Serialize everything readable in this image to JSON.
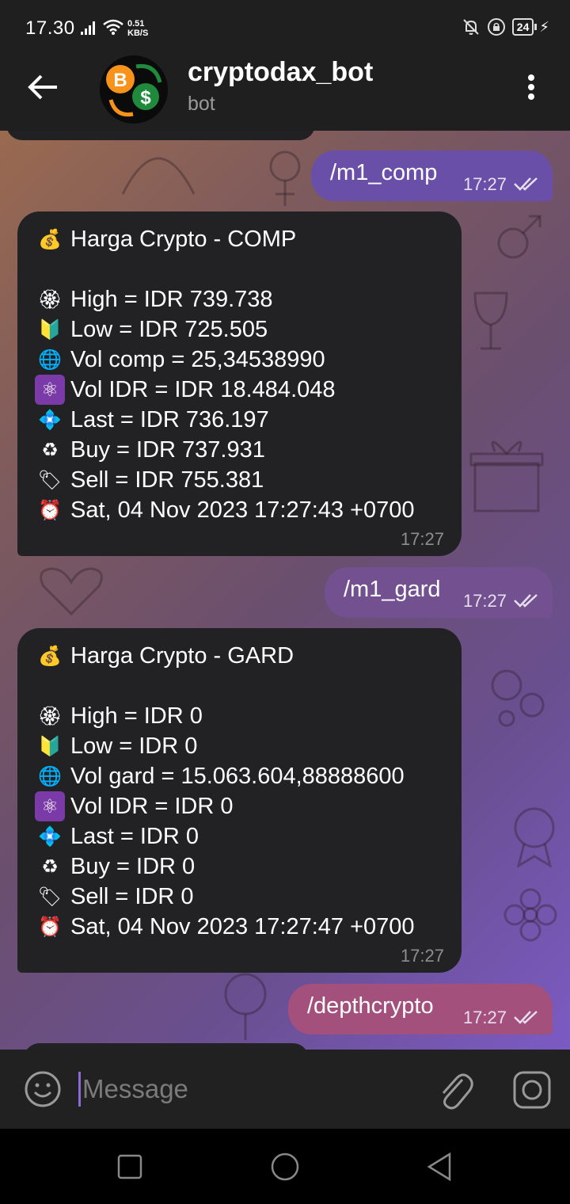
{
  "status_bar": {
    "time": "17.30",
    "net_speed_value": "0.51",
    "net_speed_unit": "KB/S",
    "battery": "24"
  },
  "header": {
    "title": "cryptodax_bot",
    "subtitle": "bot"
  },
  "messages": [
    {
      "type": "outgoing",
      "text": "/m1_comp",
      "time": "17:27",
      "color": "#6a4fa8"
    },
    {
      "type": "incoming",
      "title": "Harga Crypto - COMP",
      "lines": [
        {
          "icon": "money-bag-icon",
          "emoji": "💰",
          "text": "Harga Crypto - COMP"
        },
        {
          "icon": "blossom-icon",
          "emoji": "🏵",
          "text": "High = IDR 739.738"
        },
        {
          "icon": "beginner-icon",
          "emoji": "🔰",
          "text": "Low = IDR 725.505"
        },
        {
          "icon": "globe-icon",
          "emoji": "🌐",
          "text": "Vol comp = 25,34538990"
        },
        {
          "icon": "atom-icon",
          "emoji": "⚛",
          "text": "Vol IDR = IDR 18.484.048"
        },
        {
          "icon": "diamond-icon",
          "emoji": "💠",
          "text": "Last = IDR 736.197"
        },
        {
          "icon": "recycle-icon",
          "emoji": "♻",
          "text": "Buy = IDR 737.931"
        },
        {
          "icon": "label-icon",
          "emoji": "🏷",
          "text": "Sell = IDR 755.381"
        },
        {
          "icon": "alarm-clock-icon",
          "emoji": "⏰",
          "text": "Sat, 04 Nov 2023 17:27:43 +0700"
        }
      ],
      "time": "17:27"
    },
    {
      "type": "outgoing",
      "text": "/m1_gard",
      "time": "17:27",
      "color": "#73508f"
    },
    {
      "type": "incoming",
      "lines": [
        {
          "icon": "money-bag-icon",
          "emoji": "💰",
          "text": "Harga Crypto - GARD"
        },
        {
          "icon": "blossom-icon",
          "emoji": "🏵",
          "text": "High = IDR 0"
        },
        {
          "icon": "beginner-icon",
          "emoji": "🔰",
          "text": "Low = IDR 0"
        },
        {
          "icon": "globe-icon",
          "emoji": "🌐",
          "text": "Vol gard = 15.063.604,88888600"
        },
        {
          "icon": "atom-icon",
          "emoji": "⚛",
          "text": "Vol IDR = IDR 0"
        },
        {
          "icon": "diamond-icon",
          "emoji": "💠",
          "text": "Last = IDR 0"
        },
        {
          "icon": "recycle-icon",
          "emoji": "♻",
          "text": "Buy = IDR 0"
        },
        {
          "icon": "label-icon",
          "emoji": "🏷",
          "text": "Sell = IDR 0"
        },
        {
          "icon": "alarm-clock-icon",
          "emoji": "⏰",
          "text": "Sat, 04 Nov 2023 17:27:47 +0700"
        }
      ],
      "time": "17:27"
    },
    {
      "type": "outgoing",
      "text": "/depthcrypto",
      "time": "17:27",
      "color": "#a3507d"
    }
  ],
  "input": {
    "placeholder": "Message"
  },
  "colors": {
    "bar_background": "#1f1f1f",
    "incoming_bubble": "#222224",
    "accent_cursor": "#8b6ad8"
  }
}
